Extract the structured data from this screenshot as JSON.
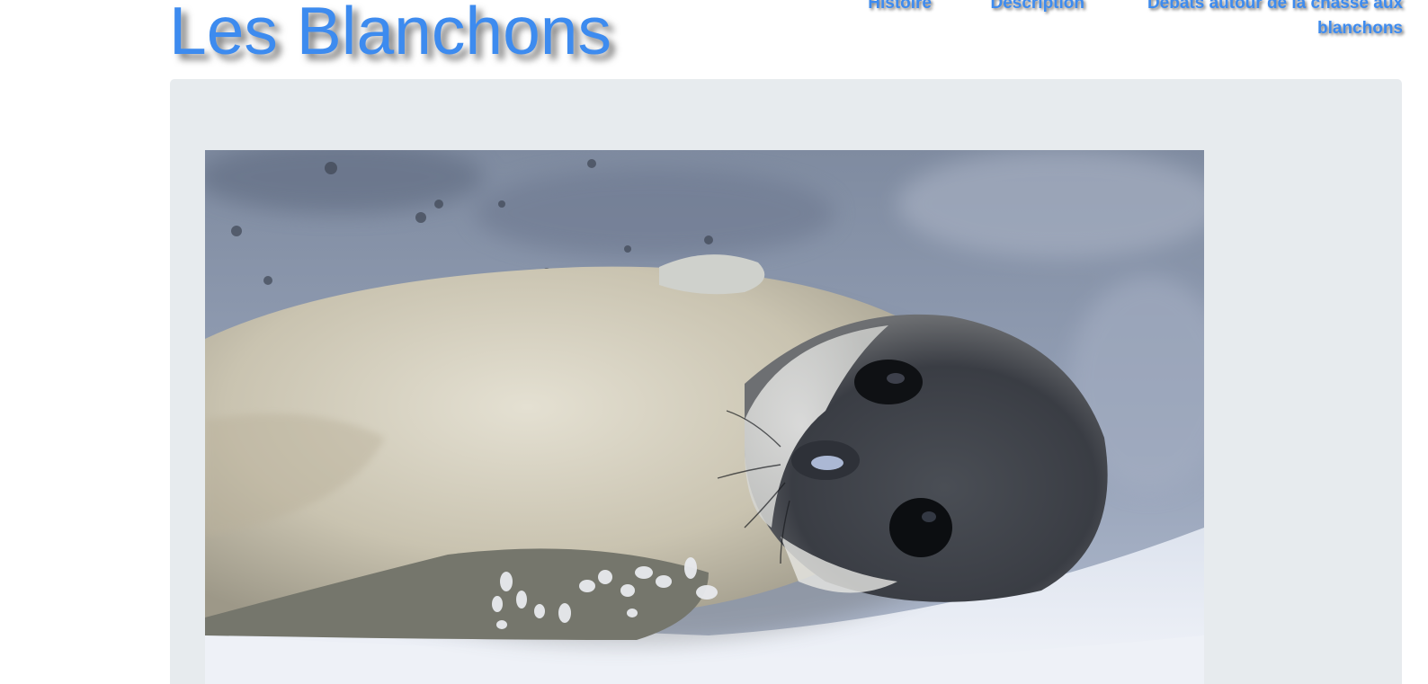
{
  "header": {
    "title": "Les Blanchons"
  },
  "nav": {
    "items": [
      {
        "label": "Histoire"
      },
      {
        "label": "Description"
      },
      {
        "label": "Débats autour de la chasse aux blanchons"
      }
    ]
  },
  "hero": {
    "image_subject": "seal pup lying on snow"
  },
  "colors": {
    "accent": "#3d8bef",
    "panel_bg": "#e7ebee"
  }
}
